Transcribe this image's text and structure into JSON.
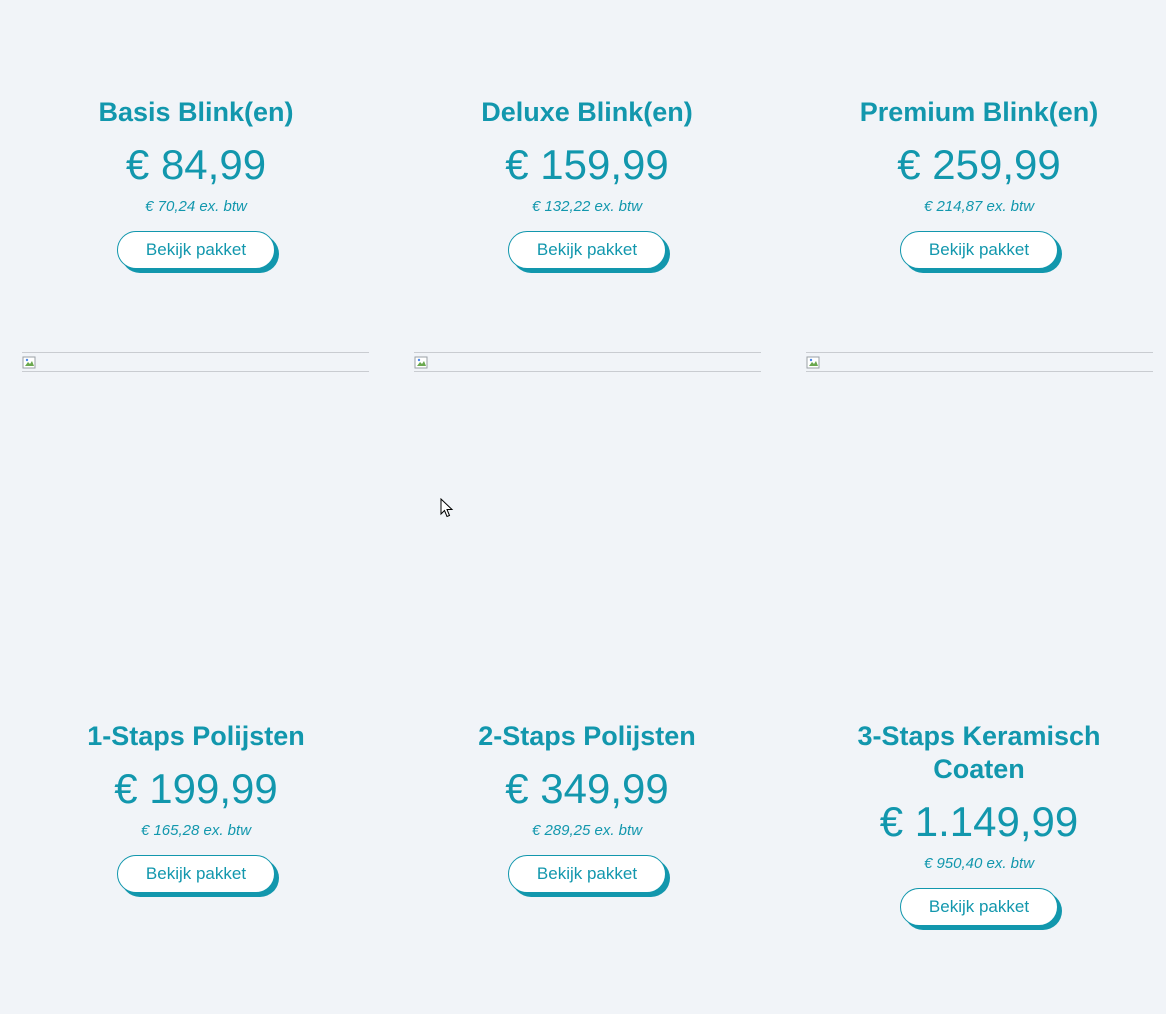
{
  "packages": [
    {
      "title": "Basis Blink(en)",
      "price": "€ 84,99",
      "price_ex": "€ 70,24 ex. btw",
      "button": "Bekijk pakket"
    },
    {
      "title": "Deluxe Blink(en)",
      "price": "€ 159,99",
      "price_ex": "€ 132,22 ex. btw",
      "button": "Bekijk pakket"
    },
    {
      "title": "Premium Blink(en)",
      "price": "€ 259,99",
      "price_ex": "€ 214,87 ex. btw",
      "button": "Bekijk pakket"
    },
    {
      "title": "1-Staps Polijsten",
      "price": "€ 199,99",
      "price_ex": "€ 165,28 ex. btw",
      "button": "Bekijk pakket"
    },
    {
      "title": "2-Staps Polijsten",
      "price": "€ 349,99",
      "price_ex": "€ 289,25 ex. btw",
      "button": "Bekijk pakket"
    },
    {
      "title": "3-Staps Keramisch Coaten",
      "price": "€ 1.149,99",
      "price_ex": "€ 950,40 ex. btw",
      "button": "Bekijk pakket"
    }
  ],
  "colors": {
    "accent": "#1297ad",
    "background": "#f1f4f8"
  }
}
